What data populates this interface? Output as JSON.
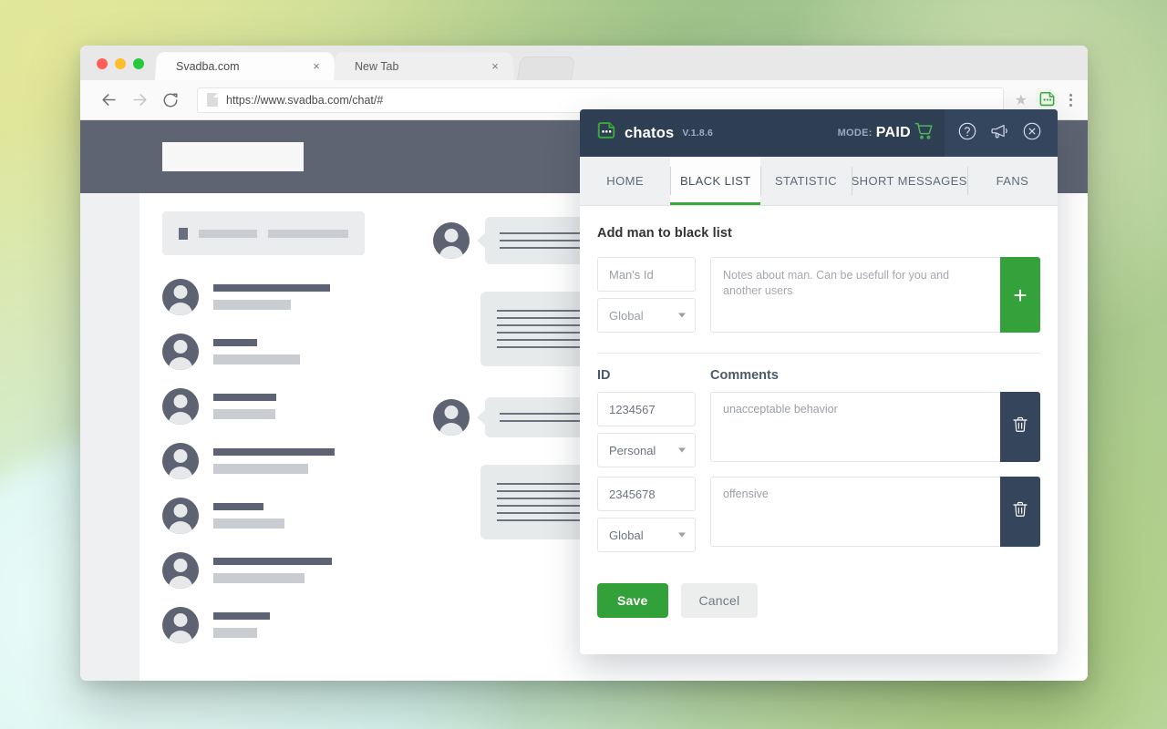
{
  "browser": {
    "tabs": [
      {
        "title": "Svadba.com",
        "active": true,
        "close_label": "×"
      },
      {
        "title": "New Tab",
        "active": false,
        "close_label": "×"
      }
    ],
    "nav": {
      "back_icon": "back-arrow-icon",
      "forward_icon": "forward-arrow-icon",
      "reload_icon": "reload-icon"
    },
    "url": "https://www.svadba.com/chat/#",
    "toolbar": {
      "bookmark_icon": "star-icon",
      "extension_icon": "chatos-extension-icon",
      "menu_icon": "kebab-menu-icon"
    }
  },
  "panel": {
    "brand": {
      "name": "chatos",
      "version": "V.1.8.6",
      "logo_icon": "chatos-logo-icon"
    },
    "mode": {
      "label": "MODE:",
      "value": "PAID",
      "cart_icon": "shopping-cart-icon"
    },
    "actions": [
      {
        "icon": "help-circle-icon",
        "name": "help-button"
      },
      {
        "icon": "megaphone-icon",
        "name": "announcements-button"
      },
      {
        "icon": "close-circle-icon",
        "name": "close-panel-button"
      }
    ],
    "tabs": [
      {
        "label": "HOME",
        "active": false
      },
      {
        "label": "BLACK LIST",
        "active": true
      },
      {
        "label": "STATISTIC",
        "active": false
      },
      {
        "label": "SHORT MESSAGES",
        "active": false
      },
      {
        "label": "FANS",
        "active": false
      }
    ],
    "add_form": {
      "title": "Add man to black list",
      "id_placeholder": "Man's Id",
      "id_value": "",
      "scope_value": "Global",
      "scope_options": [
        "Global",
        "Personal"
      ],
      "notes_placeholder": "Notes about man. Can be usefull for you and another users",
      "notes_value": "",
      "add_button_label": "+"
    },
    "table": {
      "headers": {
        "id": "ID",
        "comments": "Comments"
      },
      "rows": [
        {
          "id": "1234567",
          "scope": "Personal",
          "comment": "unacceptable behavior",
          "delete_icon": "trash-icon"
        },
        {
          "id": "2345678",
          "scope": "Global",
          "comment": "offensive",
          "delete_icon": "trash-icon"
        }
      ]
    },
    "footer": {
      "save_label": "Save",
      "cancel_label": "Cancel"
    }
  },
  "colors": {
    "accent_green": "#33a13a",
    "header_navy": "#2e3f54",
    "delete_navy": "#34455c",
    "page_header": "#5e6472"
  }
}
